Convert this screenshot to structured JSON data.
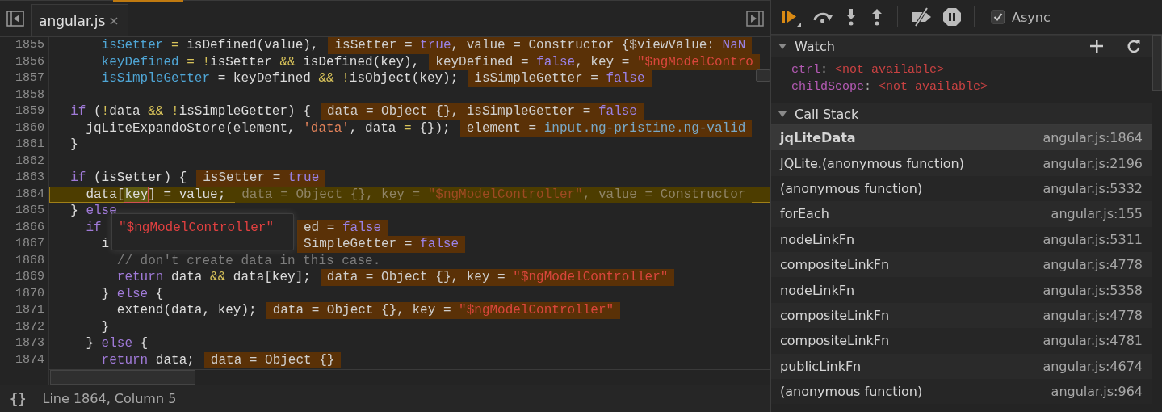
{
  "editor": {
    "tab": {
      "label": "angular.js",
      "close": "×",
      "selected": true
    },
    "lines": [
      {
        "number": "1855",
        "current": false,
        "code": [
          {
            "kind": "var",
            "text": "      isSetter"
          },
          {
            "kind": "op",
            "text": " = "
          },
          {
            "kind": "plain",
            "text": "isDefined(value),"
          }
        ],
        "values": [
          {
            "kind": "plain",
            "text": "isSetter = "
          },
          {
            "kind": "literal",
            "text": "true"
          },
          {
            "kind": "plain",
            "text": ", value = Constructor {$viewValue: "
          },
          {
            "kind": "literal",
            "text": "NaN"
          }
        ]
      },
      {
        "number": "1856",
        "current": false,
        "code": [
          {
            "kind": "var",
            "text": "      keyDefined"
          },
          {
            "kind": "op",
            "text": " = !"
          },
          {
            "kind": "plain",
            "text": "isSetter "
          },
          {
            "kind": "op",
            "text": "&&"
          },
          {
            "kind": "plain",
            "text": " isDefined(key),"
          }
        ],
        "values": [
          {
            "kind": "plain",
            "text": "keyDefined = "
          },
          {
            "kind": "literal",
            "text": "false"
          },
          {
            "kind": "plain",
            "text": ", key = "
          },
          {
            "kind": "string",
            "text": "\"$ngModelContro"
          }
        ]
      },
      {
        "number": "1857",
        "current": false,
        "code": [
          {
            "kind": "var",
            "text": "      isSimpleGetter"
          },
          {
            "kind": "plain",
            "text": " = keyDefined "
          },
          {
            "kind": "op",
            "text": "&& !"
          },
          {
            "kind": "plain",
            "text": "isObject(key);"
          }
        ],
        "values": [
          {
            "kind": "plain",
            "text": "isSimpleGetter = "
          },
          {
            "kind": "literal",
            "text": "false"
          }
        ]
      },
      {
        "number": "1858",
        "current": false
      },
      {
        "number": "1859",
        "current": false,
        "code": [
          {
            "kind": "keyword",
            "text": "  if"
          },
          {
            "kind": "plain",
            "text": " ("
          },
          {
            "kind": "op",
            "text": "!"
          },
          {
            "kind": "plain",
            "text": "data "
          },
          {
            "kind": "op",
            "text": "&& !"
          },
          {
            "kind": "plain",
            "text": "isSimpleGetter) {"
          }
        ],
        "values": [
          {
            "kind": "plain",
            "text": "data = Object {}, isSimpleGetter = "
          },
          {
            "kind": "literal",
            "text": "false"
          }
        ]
      },
      {
        "number": "1860",
        "current": false,
        "code": [
          {
            "kind": "plain",
            "text": "    jqLiteExpandoStore(element, "
          },
          {
            "kind": "codestring",
            "text": "'data'"
          },
          {
            "kind": "plain",
            "text": ", data "
          },
          {
            "kind": "op",
            "text": "="
          },
          {
            "kind": "plain",
            "text": " {});"
          }
        ],
        "values": [
          {
            "kind": "plain",
            "text": "element = "
          },
          {
            "kind": "node",
            "text": "input.ng-pristine.ng-valid"
          }
        ]
      },
      {
        "number": "1861",
        "current": false,
        "code": [
          {
            "kind": "plain",
            "text": "  }"
          }
        ]
      },
      {
        "number": "1862",
        "current": false
      },
      {
        "number": "1863",
        "current": false,
        "code": [
          {
            "kind": "keyword",
            "text": "  if"
          },
          {
            "kind": "plain",
            "text": " (isSetter) {"
          }
        ],
        "values": [
          {
            "kind": "plain",
            "text": "isSetter = "
          },
          {
            "kind": "literal",
            "text": "true"
          }
        ]
      },
      {
        "number": "1864",
        "current": true,
        "code": [
          {
            "kind": "plain",
            "text": "    data["
          },
          {
            "kind": "plain",
            "text": "key",
            "hovered": true
          },
          {
            "kind": "plain",
            "text": "] = value;"
          }
        ],
        "values": [
          {
            "kind": "plain",
            "text": "data = Object {}, key = "
          },
          {
            "kind": "string",
            "text": "\"$ngModelController\""
          },
          {
            "kind": "plain",
            "text": ", value = Constructor"
          }
        ]
      },
      {
        "number": "1865",
        "current": false,
        "code": [
          {
            "kind": "plain",
            "text": "  } "
          },
          {
            "kind": "keyword",
            "text": "else"
          }
        ]
      },
      {
        "number": "1866",
        "current": false,
        "code": [
          {
            "kind": "keyword",
            "text": "    if"
          }
        ],
        "values_behind_tooltip": true,
        "values": [
          {
            "kind": "plain",
            "text": "ed = "
          },
          {
            "kind": "literal",
            "text": "false"
          }
        ]
      },
      {
        "number": "1867",
        "current": false,
        "code": [
          {
            "kind": "plain",
            "text": "      i"
          }
        ],
        "values_behind_tooltip": true,
        "values": [
          {
            "kind": "plain",
            "text": "SimpleGetter = "
          },
          {
            "kind": "literal",
            "text": "false"
          }
        ]
      },
      {
        "number": "1868",
        "current": false,
        "code": [
          {
            "kind": "comment",
            "text": "        // don't create data in this case."
          }
        ]
      },
      {
        "number": "1869",
        "current": false,
        "code": [
          {
            "kind": "keyword",
            "text": "        return"
          },
          {
            "kind": "plain",
            "text": " data "
          },
          {
            "kind": "op",
            "text": "&&"
          },
          {
            "kind": "plain",
            "text": " data[key];"
          }
        ],
        "values": [
          {
            "kind": "plain",
            "text": "data = Object {}, key = "
          },
          {
            "kind": "string",
            "text": "\"$ngModelController\""
          }
        ]
      },
      {
        "number": "1870",
        "current": false,
        "code": [
          {
            "kind": "plain",
            "text": "      } "
          },
          {
            "kind": "keyword",
            "text": "else"
          },
          {
            "kind": "plain",
            "text": " {"
          }
        ]
      },
      {
        "number": "1871",
        "current": false,
        "code": [
          {
            "kind": "plain",
            "text": "        extend(data, key);"
          }
        ],
        "values": [
          {
            "kind": "plain",
            "text": "data = Object {}, key = "
          },
          {
            "kind": "string",
            "text": "\"$ngModelController\""
          }
        ]
      },
      {
        "number": "1872",
        "current": false,
        "code": [
          {
            "kind": "plain",
            "text": "      }"
          }
        ]
      },
      {
        "number": "1873",
        "current": false,
        "code": [
          {
            "kind": "plain",
            "text": "    } "
          },
          {
            "kind": "keyword",
            "text": "else"
          },
          {
            "kind": "plain",
            "text": " {"
          }
        ]
      },
      {
        "number": "1874",
        "current": false,
        "code": [
          {
            "kind": "keyword",
            "text": "      return"
          },
          {
            "kind": "plain",
            "text": " data;"
          }
        ],
        "values": [
          {
            "kind": "plain",
            "text": "data = Object {}"
          }
        ]
      }
    ],
    "tooltip": "\"$ngModelController\"",
    "status_bar": {
      "format_button": "{}",
      "position": "Line 1864, Column 5"
    }
  },
  "debugger": {
    "async": {
      "label": "Async",
      "checked": true
    },
    "watch": {
      "title": "Watch",
      "expanded": true,
      "expressions": [
        {
          "name": "ctrl",
          "separator": ":",
          "value": "<not available>"
        },
        {
          "name": "childScope",
          "separator": ":",
          "value": "<not available>"
        }
      ]
    },
    "call_stack": {
      "title": "Call Stack",
      "expanded": true,
      "frames": [
        {
          "name": "jqLiteData",
          "location": "angular.js:1864",
          "selected": true
        },
        {
          "name": "JQLite.(anonymous function)",
          "location": "angular.js:2196",
          "selected": false
        },
        {
          "name": "(anonymous function)",
          "location": "angular.js:5332",
          "selected": false
        },
        {
          "name": "forEach",
          "location": "angular.js:155",
          "selected": false
        },
        {
          "name": "nodeLinkFn",
          "location": "angular.js:5311",
          "selected": false
        },
        {
          "name": "compositeLinkFn",
          "location": "angular.js:4778",
          "selected": false
        },
        {
          "name": "nodeLinkFn",
          "location": "angular.js:5358",
          "selected": false
        },
        {
          "name": "compositeLinkFn",
          "location": "angular.js:4778",
          "selected": false
        },
        {
          "name": "compositeLinkFn",
          "location": "angular.js:4781",
          "selected": false
        },
        {
          "name": "publicLinkFn",
          "location": "angular.js:4674",
          "selected": false
        },
        {
          "name": "(anonymous function)",
          "location": "angular.js:964",
          "selected": false
        }
      ]
    }
  }
}
